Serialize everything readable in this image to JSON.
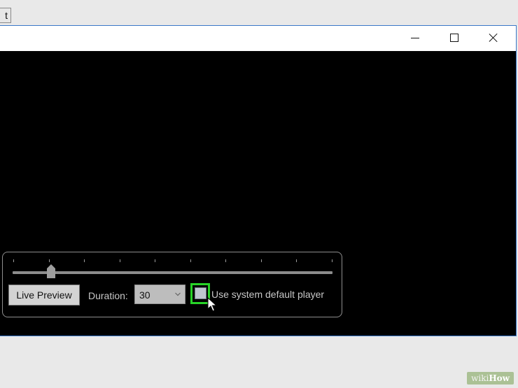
{
  "background_tab": {
    "label": "t"
  },
  "window": {
    "caption_buttons": {
      "minimize": "minimize-icon",
      "maximize": "maximize-icon",
      "close": "close-icon"
    }
  },
  "controls": {
    "slider": {
      "tick_count": 10,
      "value_fraction": 0.12
    },
    "live_preview_label": "Live Preview",
    "duration_label": "Duration:",
    "duration_value": "30",
    "default_player_checkbox": {
      "checked": false,
      "label": "Use system default player"
    }
  },
  "colors": {
    "highlight": "#27d327",
    "window_border": "#3a78c8"
  },
  "watermark": {
    "wiki": "wiki",
    "how": "How"
  }
}
